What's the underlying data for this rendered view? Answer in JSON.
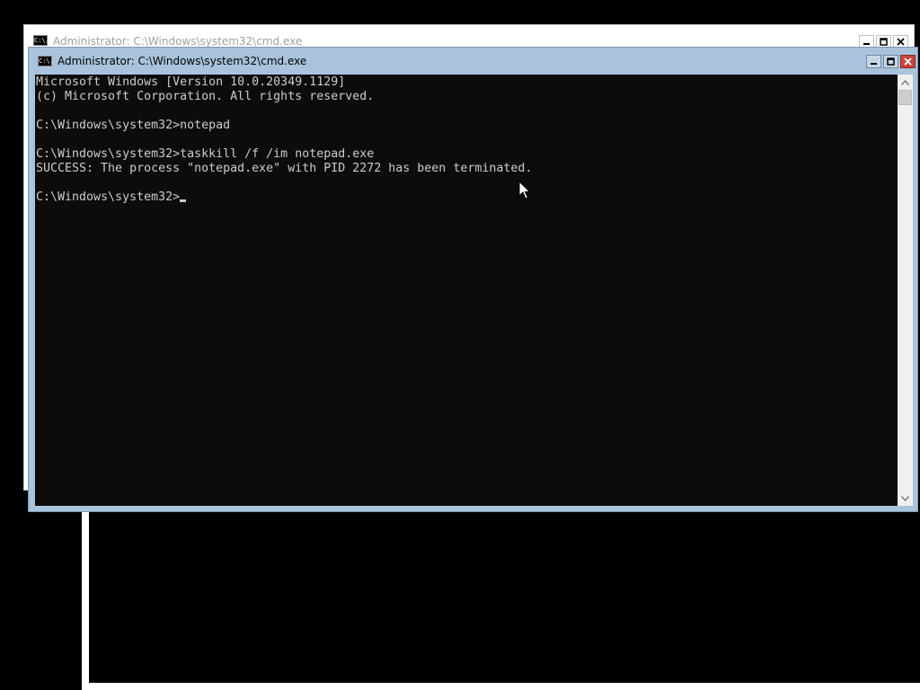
{
  "back_window_1": {
    "title": "Administrator: C:\\Windows\\system32\\cmd.exe",
    "icon": "cmd-icon",
    "icon_text": "C:\\."
  },
  "back_window_2": {},
  "main_window": {
    "title": "Administrator: C:\\Windows\\system32\\cmd.exe",
    "icon": "cmd-icon",
    "icon_text": "C:\\.",
    "controls": {
      "minimize": "minimize-icon",
      "maximize": "maximize-icon",
      "close": "close-icon"
    },
    "accent_color": "#a9c3dc",
    "close_color": "#c7453c"
  },
  "console": {
    "lines": [
      "Microsoft Windows [Version 10.0.20349.1129]",
      "(c) Microsoft Corporation. All rights reserved.",
      "",
      "C:\\Windows\\system32>notepad",
      "",
      "C:\\Windows\\system32>taskkill /f /im notepad.exe",
      "SUCCESS: The process \"notepad.exe\" with PID 2272 has been terminated.",
      "",
      "C:\\Windows\\system32>"
    ],
    "cursor": "block-cursor"
  },
  "scrollbar": {
    "up_icon": "scroll-up-arrow-icon",
    "down_icon": "scroll-down-arrow-icon"
  },
  "pointer": "mouse-pointer-icon"
}
